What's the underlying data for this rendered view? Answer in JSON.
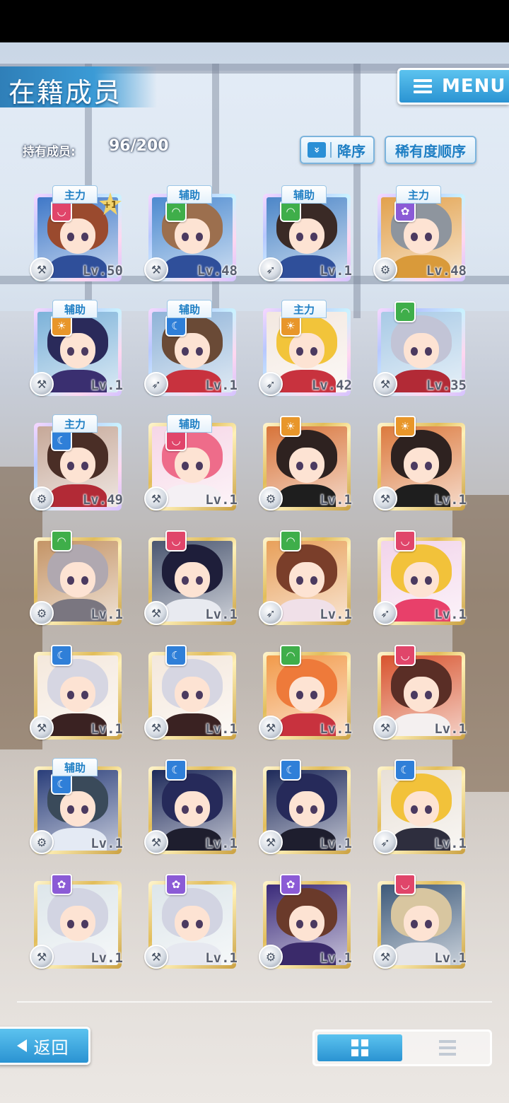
{
  "header": {
    "title": "在籍成员",
    "menu_label": "MENU"
  },
  "owned": {
    "label": "持有成员:",
    "value": "96/200"
  },
  "sort": {
    "order_label": "降序",
    "order_arrow": "»",
    "rarity_label": "稀有度顺序"
  },
  "footer": {
    "back_label": "返回"
  },
  "colors": {
    "accent": "#2a93d2",
    "attr_red": "#e0456a",
    "attr_green": "#3fae4a",
    "attr_blue": "#2f7fd8",
    "attr_purple": "#8b5bd6",
    "attr_orange": "#e8962a"
  },
  "cards": [
    {
      "role": "主力",
      "attr": "red",
      "level": "Lv.50",
      "plus": "+1",
      "frame": "rainbow",
      "weapon": "wrench",
      "hair": "#9a4a2e",
      "body": "#2f4f9a",
      "bg": "#3f78c8"
    },
    {
      "role": "辅助",
      "attr": "green",
      "level": "Lv.48",
      "plus": "",
      "frame": "rainbow",
      "weapon": "wrench",
      "hair": "#9c6f4e",
      "body": "#2f4f9a",
      "bg": "#4c8ad0"
    },
    {
      "role": "辅助",
      "attr": "green",
      "level": "Lv.1",
      "plus": "",
      "frame": "rainbow",
      "weapon": "rocket",
      "hair": "#3a2a26",
      "body": "#2f4f9a",
      "bg": "#4c86c8"
    },
    {
      "role": "主力",
      "attr": "purple",
      "level": "Lv.48",
      "plus": "",
      "frame": "rainbow",
      "weapon": "gear",
      "hair": "#8e959e",
      "body": "#d99a3a",
      "bg": "#e2a14c"
    },
    {
      "role": "辅助",
      "attr": "orange",
      "level": "Lv.1",
      "plus": "",
      "frame": "rainbow",
      "weapon": "wrench",
      "hair": "#2a2a5a",
      "body": "#3a2f70",
      "bg": "#7cb2d9"
    },
    {
      "role": "辅助",
      "attr": "blue",
      "level": "Lv.1",
      "plus": "",
      "frame": "rainbow",
      "weapon": "rocket",
      "hair": "#6a4a36",
      "body": "#c8323e",
      "bg": "#8fb3d8"
    },
    {
      "role": "主力",
      "attr": "orange",
      "level": "Lv.42",
      "plus": "",
      "frame": "rainbow",
      "weapon": "rocket",
      "hair": "#f2c43a",
      "body": "#c8323e",
      "bg": "#f3e8e0"
    },
    {
      "role": "",
      "attr": "green",
      "level": "Lv.35",
      "plus": "",
      "frame": "rainbow",
      "weapon": "wrench",
      "hair": "#c2c4d6",
      "body": "#b22a36",
      "bg": "#a8cae6"
    },
    {
      "role": "主力",
      "attr": "blue",
      "level": "Lv.49",
      "plus": "",
      "frame": "rainbow",
      "weapon": "gear",
      "hair": "#4a2e26",
      "body": "#b22a36",
      "bg": "#c6a898"
    },
    {
      "role": "辅助",
      "attr": "red",
      "level": "Lv.1",
      "plus": "",
      "frame": "gold",
      "weapon": "hammer",
      "hair": "#ee6c8a",
      "body": "#f4f0f4",
      "bg": "#f6d6e6"
    },
    {
      "role": "",
      "attr": "orange",
      "level": "Lv.1",
      "plus": "",
      "frame": "gold",
      "weapon": "gear",
      "hair": "#2e2220",
      "body": "#1e1e1e",
      "bg": "#d8743a"
    },
    {
      "role": "",
      "attr": "orange",
      "level": "Lv.1",
      "plus": "",
      "frame": "gold",
      "weapon": "wrench",
      "hair": "#2e2220",
      "body": "#1e1e1e",
      "bg": "#dc7a3e"
    },
    {
      "role": "",
      "attr": "green",
      "level": "Lv.1",
      "plus": "",
      "frame": "gold",
      "weapon": "gear",
      "hair": "#b0a8b0",
      "body": "#7a7680",
      "bg": "#c49466"
    },
    {
      "role": "",
      "attr": "red",
      "level": "Lv.1",
      "plus": "",
      "frame": "gold",
      "weapon": "wrench",
      "hair": "#1e1e3a",
      "body": "#e8eaf0",
      "bg": "#4a5670"
    },
    {
      "role": "",
      "attr": "green",
      "level": "Lv.1",
      "plus": "",
      "frame": "gold",
      "weapon": "rocket",
      "hair": "#7a3e2a",
      "body": "#f0e0e8",
      "bg": "#e8a05a"
    },
    {
      "role": "",
      "attr": "red",
      "level": "Lv.1",
      "plus": "",
      "frame": "gold",
      "weapon": "rocket",
      "hair": "#f2c23a",
      "body": "#e8406a",
      "bg": "#f2d4ea"
    },
    {
      "role": "",
      "attr": "blue",
      "level": "Lv.1",
      "plus": "",
      "frame": "gold",
      "weapon": "wrench",
      "hair": "#d6d6e2",
      "body": "#3a2222",
      "bg": "#f4e8dc"
    },
    {
      "role": "",
      "attr": "blue",
      "level": "Lv.1",
      "plus": "",
      "frame": "gold",
      "weapon": "wrench",
      "hair": "#d6d6e2",
      "body": "#3a2222",
      "bg": "#f4e8dc"
    },
    {
      "role": "",
      "attr": "green",
      "level": "Lv.1",
      "plus": "",
      "frame": "gold",
      "weapon": "hammer",
      "hair": "#ee7a3a",
      "body": "#c8323e",
      "bg": "#f29a4a"
    },
    {
      "role": "",
      "attr": "red",
      "level": "Lv.1",
      "plus": "",
      "frame": "gold",
      "weapon": "wrench",
      "hair": "#5a2e26",
      "body": "#f4f0f0",
      "bg": "#d8542e"
    },
    {
      "role": "辅助",
      "attr": "blue",
      "level": "Lv.1",
      "plus": "",
      "frame": "gold",
      "weapon": "gear",
      "hair": "#3a4a5a",
      "body": "#e4eaf4",
      "bg": "#2a3e7a"
    },
    {
      "role": "",
      "attr": "blue",
      "level": "Lv.1",
      "plus": "",
      "frame": "gold",
      "weapon": "wrench",
      "hair": "#262a5a",
      "body": "#1e1e2e",
      "bg": "#1e2a5a"
    },
    {
      "role": "",
      "attr": "blue",
      "level": "Lv.1",
      "plus": "",
      "frame": "gold",
      "weapon": "wrench",
      "hair": "#262a5a",
      "body": "#1e1e2e",
      "bg": "#1e2a5a"
    },
    {
      "role": "",
      "attr": "blue",
      "level": "Lv.1",
      "plus": "",
      "frame": "gold",
      "weapon": "rocket",
      "hair": "#f2c23a",
      "body": "#2e2e3e",
      "bg": "#e8e0d6"
    },
    {
      "role": "",
      "attr": "purple",
      "level": "Lv.1",
      "plus": "",
      "frame": "gold",
      "weapon": "wrench",
      "hair": "#d2d4e2",
      "body": "#e6e8f0",
      "bg": "#dde6ea"
    },
    {
      "role": "",
      "attr": "purple",
      "level": "Lv.1",
      "plus": "",
      "frame": "gold",
      "weapon": "wrench",
      "hair": "#d2d4e2",
      "body": "#e6e8f0",
      "bg": "#dde6ea"
    },
    {
      "role": "",
      "attr": "purple",
      "level": "Lv.1",
      "plus": "",
      "frame": "gold",
      "weapon": "gear",
      "hair": "#6a3a2a",
      "body": "#3a2a6a",
      "bg": "#3a2a7a"
    },
    {
      "role": "",
      "attr": "red",
      "level": "Lv.1",
      "plus": "",
      "frame": "gold",
      "weapon": "wrench",
      "hair": "#d8c6a0",
      "body": "#e6e6ea",
      "bg": "#3e5a7a"
    }
  ]
}
